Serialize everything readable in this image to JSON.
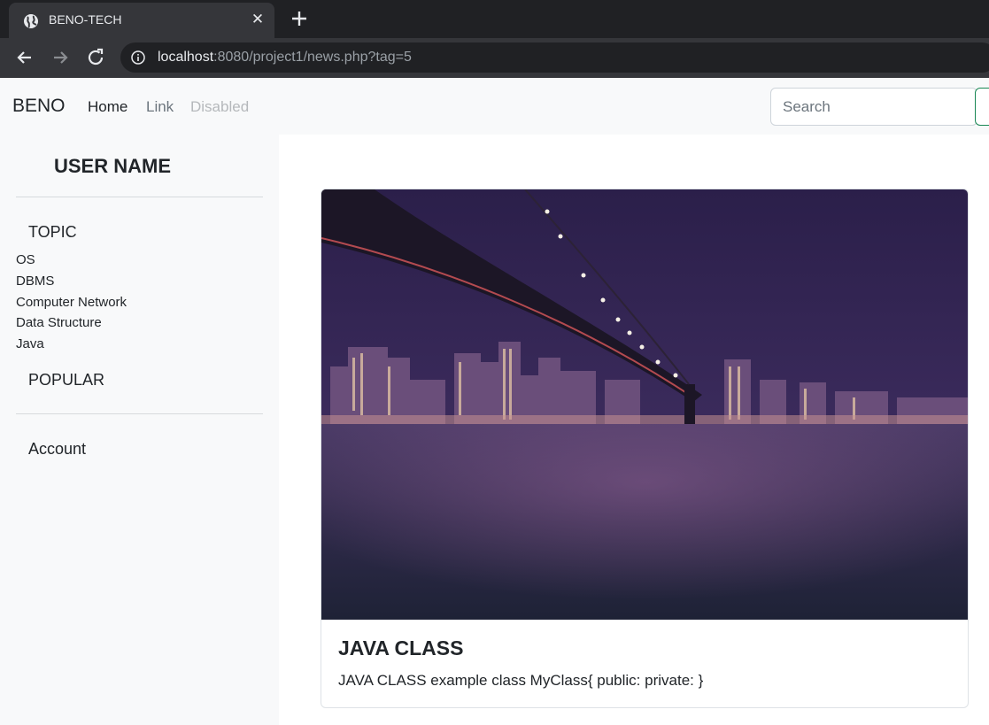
{
  "browser": {
    "tab_title": "BENO-TECH",
    "url_host": "localhost",
    "url_rest": ":8080/project1/news.php?tag=5"
  },
  "navbar": {
    "brand": "BENO",
    "links": [
      "Home",
      "Link",
      "Disabled"
    ],
    "search_placeholder": "Search"
  },
  "sidebar": {
    "username": "USER NAME",
    "topic_heading": "TOPIC",
    "topics": [
      "OS",
      "DBMS",
      "Computer Network",
      "Data Structure",
      "Java"
    ],
    "popular_heading": "POPULAR",
    "account_label": "Account"
  },
  "card": {
    "title": "JAVA CLASS",
    "text": "JAVA CLASS example class MyClass{ public: private: }"
  },
  "colors": {
    "chrome_dark": "#202124",
    "chrome_tab": "#35363a",
    "page_light": "#f8f9fa",
    "search_button_border": "#198754"
  }
}
